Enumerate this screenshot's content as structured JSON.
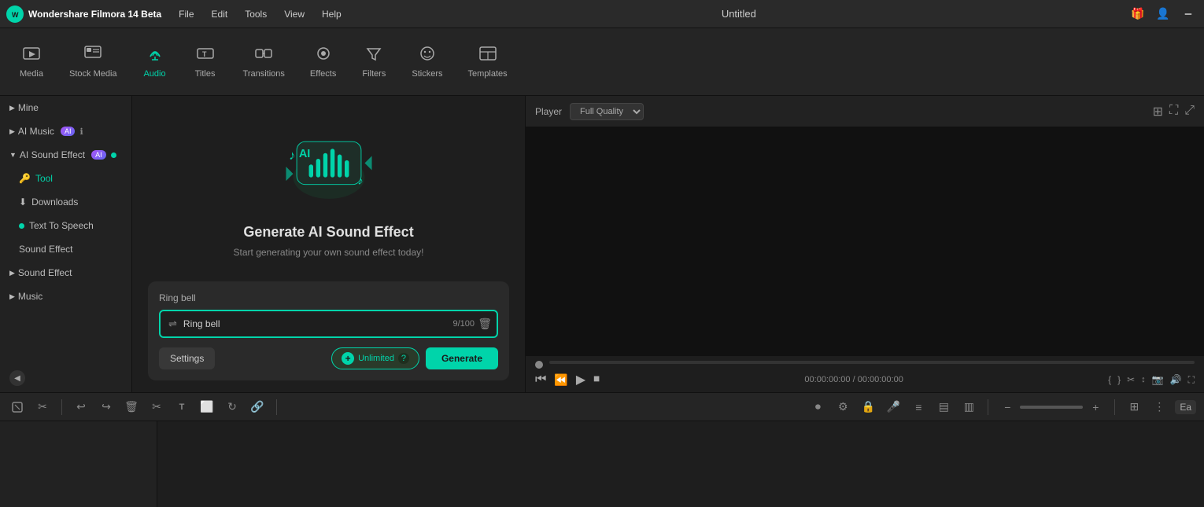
{
  "app": {
    "name": "Wondershare Filmora 14 Beta",
    "logo_text": "W",
    "title": "Untitled"
  },
  "menu": {
    "items": [
      "File",
      "Edit",
      "Tools",
      "View",
      "Help"
    ]
  },
  "toolbar": {
    "items": [
      {
        "id": "media",
        "label": "Media",
        "icon": "🎬"
      },
      {
        "id": "stock_media",
        "label": "Stock Media",
        "icon": "📦"
      },
      {
        "id": "audio",
        "label": "Audio",
        "icon": "🎵"
      },
      {
        "id": "titles",
        "label": "Titles",
        "icon": "T"
      },
      {
        "id": "transitions",
        "label": "Transitions",
        "icon": "⇄"
      },
      {
        "id": "effects",
        "label": "Effects",
        "icon": "✦"
      },
      {
        "id": "filters",
        "label": "Filters",
        "icon": "◈"
      },
      {
        "id": "stickers",
        "label": "Stickers",
        "icon": "⬡"
      },
      {
        "id": "templates",
        "label": "Templates",
        "icon": "▣"
      }
    ]
  },
  "sidebar": {
    "sections": [
      {
        "id": "mine",
        "label": "Mine",
        "expanded": false,
        "type": "root"
      },
      {
        "id": "ai_music",
        "label": "AI Music",
        "expanded": false,
        "type": "root",
        "badge": "AI"
      },
      {
        "id": "ai_sound_effect",
        "label": "AI Sound Effect",
        "expanded": true,
        "type": "root",
        "badge": "AI",
        "children": [
          {
            "id": "tool",
            "label": "Tool",
            "icon": "key"
          },
          {
            "id": "downloads",
            "label": "Downloads",
            "icon": "download"
          },
          {
            "id": "text_to_speech",
            "label": "Text To Speech",
            "icon": null,
            "dot": true
          },
          {
            "id": "sound_effect_sub",
            "label": "Sound Effect",
            "icon": null
          }
        ]
      },
      {
        "id": "sound_effect",
        "label": "Sound Effect",
        "expanded": false,
        "type": "root"
      },
      {
        "id": "music",
        "label": "Music",
        "expanded": false,
        "type": "root"
      }
    ]
  },
  "content": {
    "generate_title": "Generate AI Sound Effect",
    "generate_subtitle": "Start generating your own sound effect today!",
    "input": {
      "label": "Ring bell",
      "placeholder": "Ring bell",
      "char_count": "9/100"
    },
    "buttons": {
      "settings": "Settings",
      "unlimited": "Unlimited",
      "generate": "Generate",
      "help_icon": "?"
    }
  },
  "player": {
    "label": "Player",
    "quality": "Full Quality",
    "time_current": "00:00:00:00",
    "time_total": "00:00:00:00"
  },
  "timeline_toolbar": {
    "zoom_label": "Zoom"
  },
  "bottom_corner": {
    "text": "Ea"
  }
}
